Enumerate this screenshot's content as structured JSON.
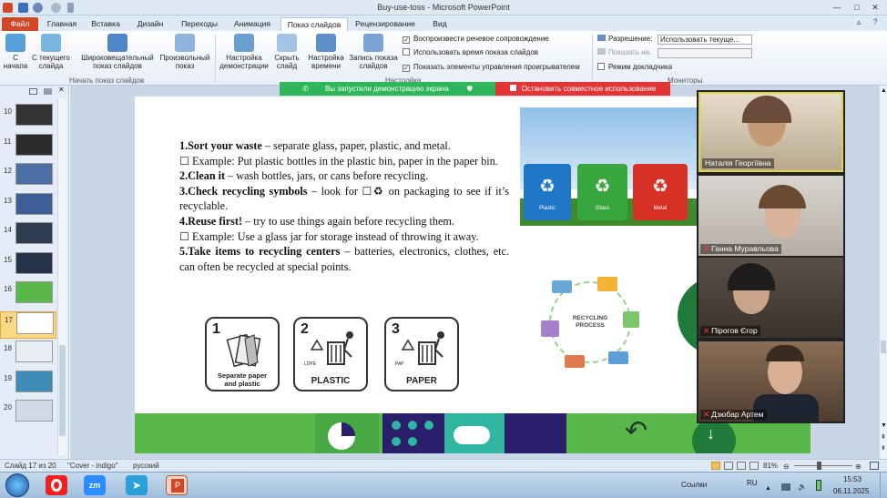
{
  "window": {
    "title": "Buy-use-toss - Microsoft PowerPoint"
  },
  "tabs": [
    "Файл",
    "Главная",
    "Вставка",
    "Дизайн",
    "Переходы",
    "Анимация",
    "Показ слайдов",
    "Рецензирование",
    "Вид"
  ],
  "ribbon": {
    "start_show": {
      "buttons": [
        "С начала",
        "С текущего слайда",
        "Широковещательный показ слайдов",
        "Произвольный показ"
      ],
      "group_label": "Начать показ слайдов"
    },
    "setup": {
      "buttons": [
        "Настройка демонстрации",
        "Скрыть слайд",
        "Настройка времени",
        "Запись показа слайдов"
      ],
      "group_label": "Настройка",
      "checks": [
        {
          "label": "Воспроизвести речевое сопровождение",
          "checked": true
        },
        {
          "label": "Использовать время показа слайдов",
          "checked": false
        },
        {
          "label": "Показать элементы управления проигрывателем",
          "checked": true
        }
      ]
    },
    "monitors": {
      "group_label": "Мониторы",
      "resolution_label": "Разрешение:",
      "resolution_value": "Использовать текуще...",
      "show_on_label": "Показать на:",
      "presenter_view": "Режим докладчика"
    }
  },
  "share_bar": {
    "status": "Вы запустили демонстрацию экрана",
    "stop": "Остановить совместное использование"
  },
  "thumbnails": {
    "numbers": [
      "10",
      "11",
      "12",
      "13",
      "14",
      "15",
      "16",
      "17",
      "18",
      "19",
      "20"
    ],
    "selected": "17"
  },
  "slide": {
    "items": [
      {
        "head": "1.Sort your waste",
        "rest": " – separate glass, paper, plastic, and metal."
      },
      {
        "head": "",
        "rest": "☐ Example: Put plastic bottles in the plastic bin, paper in the paper bin."
      },
      {
        "head": "2.Clean it",
        "rest": " – wash bottles, jars, or cans before recycling."
      },
      {
        "head": "3.Check recycling symbols",
        "rest": " – look for ☐♻ on packaging to see if it’s recyclable."
      },
      {
        "head": "4.Reuse first!",
        "rest": " – try to use things again before recycling them."
      },
      {
        "head": "",
        "rest": "☐ Example: Use a glass jar for storage instead of throwing it away."
      },
      {
        "head": "5.Take items to recycling centers",
        "rest": " – batteries, electronics, clothes, etc. can often be recycled at special points."
      }
    ],
    "symbols": [
      {
        "num": "1",
        "caption": "Separate paper and plastic",
        "sub": ""
      },
      {
        "num": "2",
        "caption": "PLASTIC",
        "sub": "LDPE"
      },
      {
        "num": "3",
        "caption": "PAPER",
        "sub": "PAP"
      }
    ],
    "bins": [
      "Plastic",
      "Glass",
      "Metal"
    ],
    "cycle_label": "RECYCLING PROCESS"
  },
  "participants": [
    {
      "name": "Наталія Георгіївна",
      "muted": false
    },
    {
      "name": "Ганна Муравльова",
      "muted": true
    },
    {
      "name": "Пірогов Єгор",
      "muted": true
    },
    {
      "name": "Дзюбар Артем",
      "muted": true
    }
  ],
  "status": {
    "slide": "Слайд 17 из 20",
    "theme": "\"Cover - indigo\"",
    "language": "русский",
    "zoom": "81%"
  },
  "taskbar": {
    "links": "Ссылки",
    "lang": "RU",
    "time": "15:53",
    "date": "06.11.2025"
  },
  "colors": {
    "ribbon_bg": "#dfe9f5",
    "file_tab": "#d24726",
    "share_green": "#2fb65a",
    "share_red": "#e33535",
    "slide_band": "#5ab84b"
  }
}
